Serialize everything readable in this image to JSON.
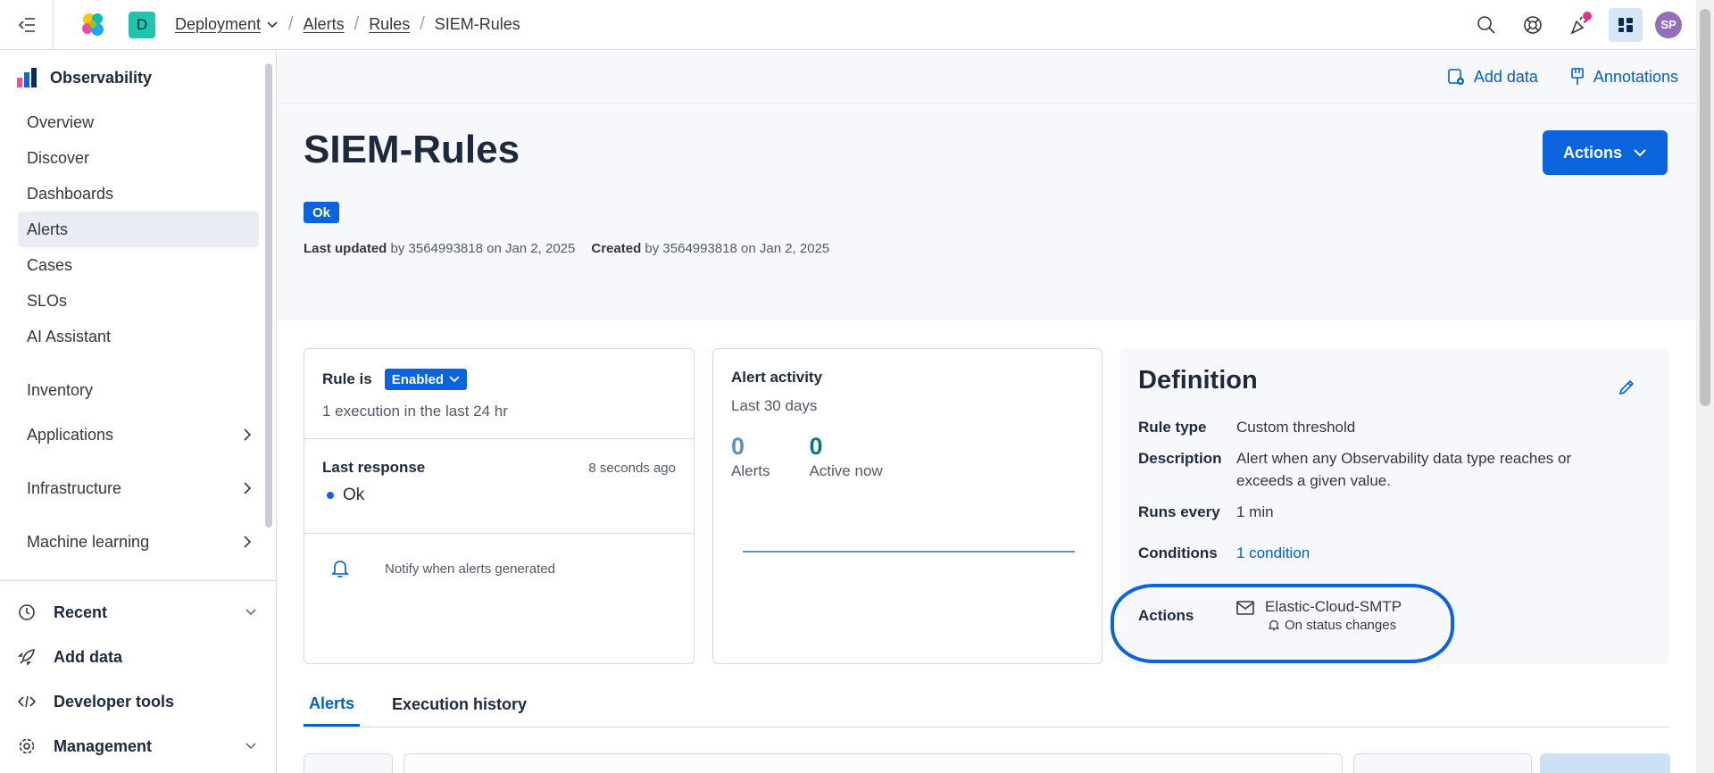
{
  "breadcrumbs": {
    "space_initial": "D",
    "deployment": "Deployment",
    "alerts": "Alerts",
    "rules": "Rules",
    "current": "SIEM-Rules"
  },
  "user": {
    "initials": "SP"
  },
  "sidebar": {
    "title": "Observability",
    "items": [
      {
        "label": "Overview"
      },
      {
        "label": "Discover"
      },
      {
        "label": "Dashboards"
      },
      {
        "label": "Alerts"
      },
      {
        "label": "Cases"
      },
      {
        "label": "SLOs"
      },
      {
        "label": "AI Assistant"
      }
    ],
    "inventory": "Inventory",
    "groups": [
      {
        "label": "Applications"
      },
      {
        "label": "Infrastructure"
      },
      {
        "label": "Machine learning"
      }
    ],
    "bottom": [
      {
        "label": "Recent"
      },
      {
        "label": "Add data"
      },
      {
        "label": "Developer tools"
      },
      {
        "label": "Management"
      }
    ]
  },
  "header": {
    "add_data": "Add data",
    "annotations": "Annotations",
    "title": "SIEM-Rules",
    "actions_button": "Actions",
    "status": "Ok",
    "last_updated_label": "Last updated",
    "last_updated_text": "by 3564993818 on Jan 2, 2025",
    "created_label": "Created",
    "created_text": "by 3564993818 on Jan 2, 2025"
  },
  "rule_card": {
    "rule_is": "Rule is",
    "enabled": "Enabled",
    "executions": "1 execution in the last 24 hr",
    "last_response": "Last response",
    "last_response_time": "8 seconds ago",
    "last_response_status": "Ok",
    "notify": "Notify when alerts generated"
  },
  "activity_card": {
    "title": "Alert activity",
    "period": "Last 30 days",
    "alerts_value": "0",
    "alerts_label": "Alerts",
    "active_value": "0",
    "active_label": "Active now"
  },
  "definition": {
    "title": "Definition",
    "rule_type_label": "Rule type",
    "rule_type": "Custom threshold",
    "description_label": "Description",
    "description": "Alert when any Observability data type reaches or exceeds a given value.",
    "runs_every_label": "Runs every",
    "runs_every": "1 min",
    "conditions_label": "Conditions",
    "conditions": "1 condition",
    "actions_label": "Actions",
    "connector": "Elastic-Cloud-SMTP",
    "connector_frequency": "On status changes"
  },
  "tabs": [
    {
      "label": "Alerts"
    },
    {
      "label": "Execution history"
    }
  ],
  "colors": {
    "primary": "#0b64dd",
    "link": "#0061c6",
    "success": "#017d73"
  }
}
